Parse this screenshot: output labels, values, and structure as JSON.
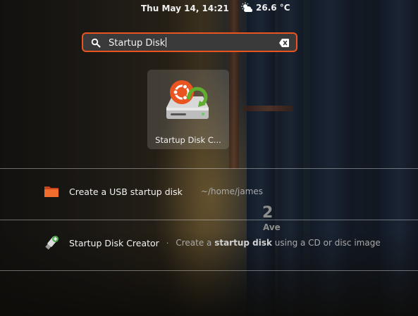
{
  "topbar": {
    "clock": "Thu May 14, 14:21",
    "weather_icon": "weather-few-clouds-icon",
    "temperature": "26.6 °C"
  },
  "search": {
    "value": "Startup Disk",
    "icon": "search-icon",
    "clear_icon": "clear-icon"
  },
  "app_grid": {
    "items": [
      {
        "label": "Startup Disk C...",
        "icon": "startup-disk-creator-icon"
      }
    ]
  },
  "results": [
    {
      "icon": "folder-icon",
      "title": "Create a USB startup disk",
      "subtitle": "~/home/james"
    },
    {
      "icon": "usb-creator-icon",
      "title": "Startup Disk Creator",
      "separator": "·",
      "desc_pre": "Create a ",
      "desc_bold": "startup disk",
      "desc_post": " using a CD or disc image"
    }
  ],
  "wallpaper": {
    "sign_number": "2",
    "sign_text": "Ave"
  },
  "colors": {
    "accent": "#e95420"
  }
}
